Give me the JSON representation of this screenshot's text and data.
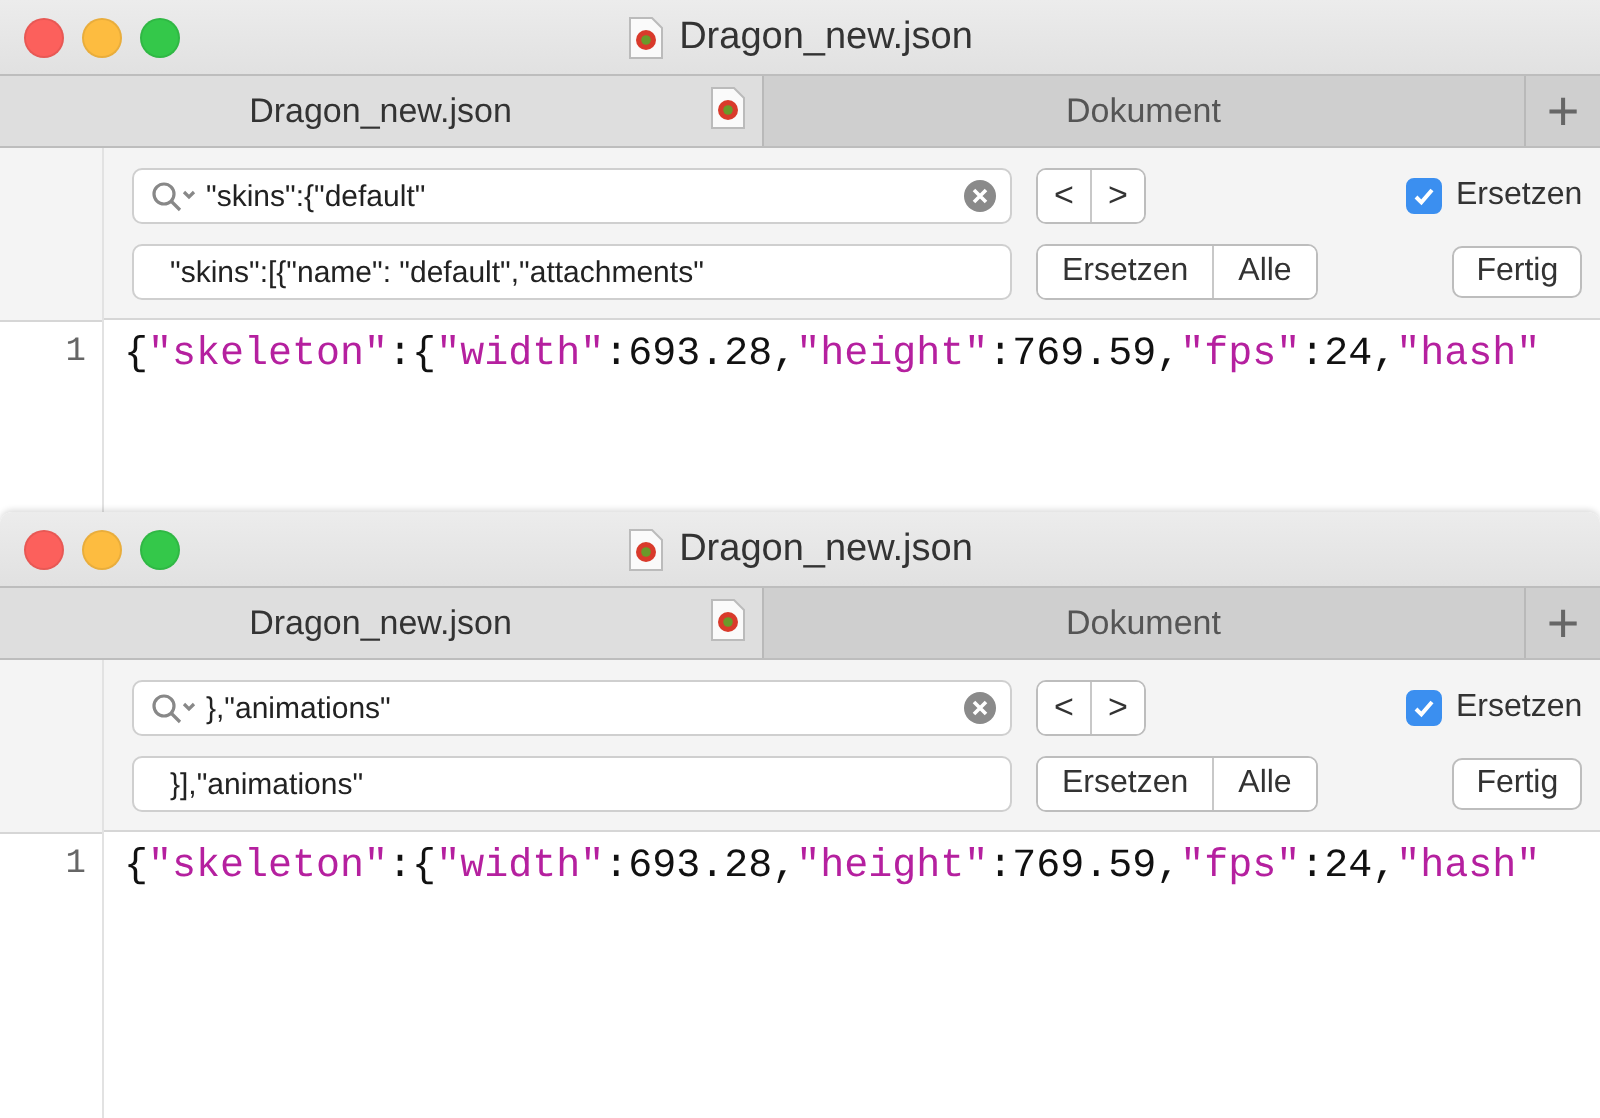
{
  "windows": [
    {
      "title": "Dragon_new.json",
      "tabs": [
        {
          "label": "Dragon_new.json",
          "selected": true
        },
        {
          "label": "Dokument",
          "selected": false
        }
      ],
      "new_tab": "+",
      "find": {
        "search": "\"skins\":{\"default\"",
        "replace": "\"skins\":[{\"name\": \"default\",\"attachments\"",
        "prev": "<",
        "next": ">",
        "replace_toggle": {
          "label": "Ersetzen",
          "checked": true
        },
        "buttons": [
          "Ersetzen",
          "Alle"
        ],
        "done": "Fertig"
      },
      "lines": [
        {
          "number": "1",
          "tokens": [
            {
              "kind": "plain",
              "text": "{"
            },
            {
              "kind": "string",
              "text": "\"skeleton\""
            },
            {
              "kind": "plain",
              "text": ":{"
            },
            {
              "kind": "string",
              "text": "\"width\""
            },
            {
              "kind": "plain",
              "text": ":693.28,"
            },
            {
              "kind": "string",
              "text": "\"height\""
            },
            {
              "kind": "plain",
              "text": ":769.59,"
            },
            {
              "kind": "string",
              "text": "\"fps\""
            },
            {
              "kind": "plain",
              "text": ":24,"
            },
            {
              "kind": "string",
              "text": "\"hash\""
            }
          ]
        }
      ]
    },
    {
      "title": "Dragon_new.json",
      "tabs": [
        {
          "label": "Dragon_new.json",
          "selected": true
        },
        {
          "label": "Dokument",
          "selected": false
        }
      ],
      "new_tab": "+",
      "find": {
        "search": "},\"animations\"",
        "replace": "}],\"animations\"",
        "prev": "<",
        "next": ">",
        "replace_toggle": {
          "label": "Ersetzen",
          "checked": true
        },
        "buttons": [
          "Ersetzen",
          "Alle"
        ],
        "done": "Fertig"
      },
      "lines": [
        {
          "number": "1",
          "tokens": [
            {
              "kind": "plain",
              "text": "{"
            },
            {
              "kind": "string",
              "text": "\"skeleton\""
            },
            {
              "kind": "plain",
              "text": ":{"
            },
            {
              "kind": "string",
              "text": "\"width\""
            },
            {
              "kind": "plain",
              "text": ":693.28,"
            },
            {
              "kind": "string",
              "text": "\"height\""
            },
            {
              "kind": "plain",
              "text": ":769.59,"
            },
            {
              "kind": "string",
              "text": "\"fps\""
            },
            {
              "kind": "plain",
              "text": ":24,"
            },
            {
              "kind": "string",
              "text": "\"hash\""
            }
          ]
        }
      ]
    }
  ]
}
